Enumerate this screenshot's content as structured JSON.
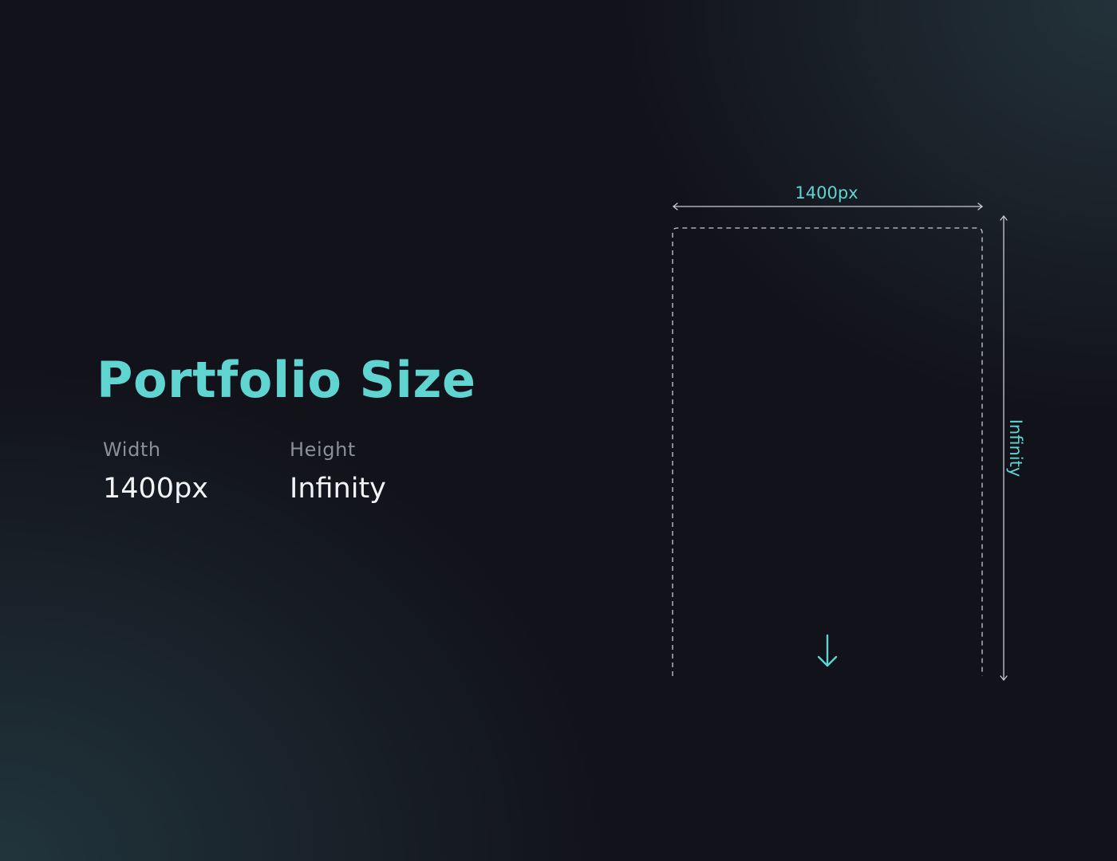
{
  "title": "Portfolio Size",
  "specs": {
    "width": {
      "label": "Width",
      "value": "1400px"
    },
    "height": {
      "label": "Height",
      "value": "Infinity"
    }
  },
  "diagram": {
    "width_label": "1400px",
    "height_label": "Infinity",
    "scroll_icon": "arrow-down-icon"
  },
  "colors": {
    "accent": "#5fd4d1",
    "background": "#12121a",
    "label": "#8b9098",
    "value": "#f2f3f5",
    "line": "#c9cdd2"
  }
}
